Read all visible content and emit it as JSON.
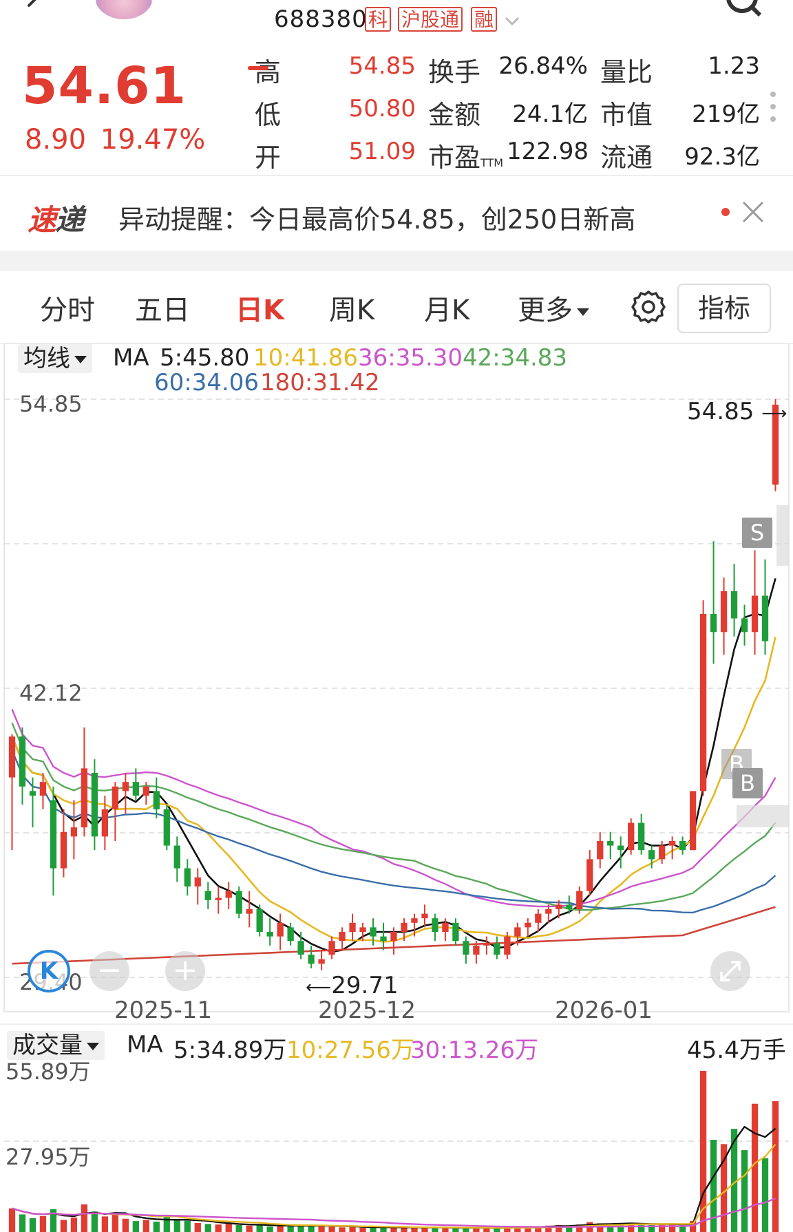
{
  "header": {
    "stock_code": "688380",
    "tags": [
      "科",
      "沪股通",
      "融"
    ]
  },
  "quote": {
    "price": "54.61",
    "change": "8.90",
    "change_pct": "19.47%",
    "high_label": "高",
    "high": "54.85",
    "low_label": "低",
    "low": "50.80",
    "open_label": "开",
    "open": "51.09",
    "turnover_label": "换手",
    "turnover": "26.84%",
    "amount_label": "金额",
    "amount": "24.1亿",
    "pe_label": "市盈",
    "pe_sub": "TTM",
    "pe": "122.98",
    "vol_ratio_label": "量比",
    "vol_ratio": "1.23",
    "mkt_cap_label": "市值",
    "mkt_cap": "219亿",
    "float_label": "流通",
    "float": "92.3亿"
  },
  "alert": {
    "logo_a": "速",
    "logo_b": "递",
    "text": "异动提醒：今日最高价54.85，创250日新高"
  },
  "tabs": {
    "items": [
      "分时",
      "五日",
      "日K",
      "周K",
      "月K",
      "更多"
    ],
    "active": "日K",
    "indicator_button": "指标"
  },
  "ma_panel": {
    "selector": "均线",
    "prefix": "MA",
    "ma5": "5:45.80",
    "ma10": "10:41.86",
    "ma36": "36:35.30",
    "ma42": "42:34.83",
    "ma60": "60:34.06",
    "ma180": "180:31.42"
  },
  "volume_panel": {
    "selector": "成交量",
    "prefix": "MA",
    "ma5": "5:34.89万",
    "ma10": "10:27.56万",
    "ma30": "30:13.26万",
    "current": "45.4万手",
    "axis_top": "55.89万",
    "axis_mid": "27.95万"
  },
  "chart_labels": {
    "price_top": "54.85",
    "price_mid": "42.12",
    "price_low": "29.40",
    "high_marker": "54.85",
    "low_marker": "29.71",
    "dates": [
      "2025-11",
      "2025-12",
      "2026-01"
    ],
    "signal_s": "S",
    "signal_b": "B",
    "k_button": "K"
  },
  "colors": {
    "up": "#e03c31",
    "down": "#1e9e3a",
    "ma5": "#111111",
    "ma10": "#e6b822",
    "ma36": "#cc55cc",
    "ma42": "#5aa85a",
    "ma60": "#3a6ea8",
    "ma180": "#d0453a"
  },
  "chart_data": {
    "type": "candlestick",
    "ylim": [
      29.4,
      54.85
    ],
    "ohlc": [
      [
        38.2,
        40.1,
        35.0,
        40.0
      ],
      [
        40.0,
        40.4,
        37.0,
        37.8
      ],
      [
        37.6,
        38.2,
        36.0,
        37.4
      ],
      [
        37.4,
        38.4,
        36.8,
        38.0
      ],
      [
        37.2,
        37.8,
        33.0,
        34.2
      ],
      [
        34.2,
        36.8,
        33.8,
        35.8
      ],
      [
        35.6,
        37.2,
        34.6,
        36.0
      ],
      [
        36.0,
        40.4,
        35.6,
        38.6
      ],
      [
        38.4,
        39.0,
        35.0,
        35.6
      ],
      [
        35.6,
        37.4,
        35.0,
        36.8
      ],
      [
        36.8,
        38.0,
        35.4,
        37.8
      ],
      [
        37.6,
        38.4,
        36.6,
        38.0
      ],
      [
        38.0,
        38.6,
        37.2,
        37.4
      ],
      [
        37.4,
        38.0,
        37.0,
        37.8
      ],
      [
        37.6,
        38.2,
        36.4,
        36.8
      ],
      [
        36.8,
        37.0,
        35.0,
        35.2
      ],
      [
        35.2,
        35.6,
        33.6,
        34.2
      ],
      [
        34.2,
        34.6,
        33.0,
        33.4
      ],
      [
        33.4,
        34.2,
        32.6,
        33.8
      ],
      [
        33.2,
        33.6,
        32.4,
        32.8
      ],
      [
        32.8,
        33.4,
        32.2,
        32.9
      ],
      [
        32.9,
        33.6,
        32.4,
        33.2
      ],
      [
        33.2,
        33.4,
        32.0,
        32.2
      ],
      [
        32.2,
        33.2,
        31.6,
        32.4
      ],
      [
        32.4,
        32.6,
        31.2,
        31.4
      ],
      [
        31.4,
        32.0,
        30.8,
        31.2
      ],
      [
        31.2,
        32.2,
        30.6,
        31.8
      ],
      [
        31.6,
        31.8,
        30.8,
        31.0
      ],
      [
        31.0,
        31.4,
        30.2,
        30.4
      ],
      [
        30.4,
        30.8,
        29.8,
        30.0
      ],
      [
        30.0,
        30.6,
        29.71,
        30.2
      ],
      [
        30.4,
        31.2,
        30.2,
        31.0
      ],
      [
        31.0,
        31.6,
        30.6,
        31.4
      ],
      [
        31.4,
        32.2,
        31.0,
        31.8
      ],
      [
        31.4,
        31.8,
        31.0,
        31.6
      ],
      [
        31.6,
        32.0,
        30.8,
        31.2
      ],
      [
        31.2,
        31.8,
        30.6,
        31.0
      ],
      [
        31.0,
        31.6,
        30.4,
        31.4
      ],
      [
        31.4,
        32.0,
        31.0,
        31.8
      ],
      [
        31.8,
        32.2,
        31.2,
        32.0
      ],
      [
        32.0,
        32.6,
        31.6,
        32.2
      ],
      [
        32.0,
        32.2,
        31.0,
        31.4
      ],
      [
        31.4,
        32.0,
        31.0,
        31.8
      ],
      [
        31.8,
        32.0,
        30.8,
        31.0
      ],
      [
        31.0,
        31.2,
        30.0,
        30.4
      ],
      [
        30.4,
        31.0,
        30.0,
        30.8
      ],
      [
        30.8,
        31.2,
        30.4,
        30.9
      ],
      [
        30.9,
        31.2,
        30.2,
        30.4
      ],
      [
        30.4,
        31.4,
        30.2,
        31.2
      ],
      [
        31.2,
        31.8,
        30.8,
        31.6
      ],
      [
        31.6,
        32.0,
        31.2,
        31.8
      ],
      [
        31.8,
        32.4,
        31.4,
        32.2
      ],
      [
        32.2,
        32.6,
        31.8,
        32.4
      ],
      [
        32.4,
        32.8,
        32.0,
        32.6
      ],
      [
        32.6,
        33.0,
        32.2,
        32.4
      ],
      [
        32.4,
        33.4,
        32.2,
        33.2
      ],
      [
        33.2,
        35.0,
        33.0,
        34.6
      ],
      [
        34.6,
        35.8,
        34.2,
        35.4
      ],
      [
        35.4,
        35.8,
        34.6,
        35.2
      ],
      [
        35.2,
        35.6,
        34.2,
        35.0
      ],
      [
        35.0,
        36.4,
        34.8,
        36.2
      ],
      [
        36.2,
        36.6,
        34.8,
        35.0
      ],
      [
        35.0,
        35.2,
        34.2,
        34.6
      ],
      [
        34.6,
        35.4,
        34.4,
        35.2
      ],
      [
        35.2,
        35.6,
        34.6,
        35.4
      ],
      [
        35.4,
        35.6,
        34.8,
        35.0
      ],
      [
        35.0,
        37.6,
        35.0,
        37.6
      ],
      [
        37.6,
        46.0,
        37.4,
        45.4
      ],
      [
        45.4,
        48.6,
        43.2,
        44.6
      ],
      [
        44.6,
        47.0,
        43.6,
        46.4
      ],
      [
        46.4,
        47.6,
        44.4,
        45.2
      ],
      [
        45.2,
        45.8,
        44.0,
        44.6
      ],
      [
        44.6,
        48.2,
        43.6,
        46.2
      ],
      [
        46.2,
        47.8,
        43.6,
        44.2
      ],
      [
        51.09,
        54.85,
        50.8,
        54.61
      ]
    ],
    "volume": [
      8.2,
      6.1,
      4.8,
      5.5,
      7.9,
      4.2,
      5.0,
      9.6,
      7.1,
      5.4,
      6.0,
      4.6,
      3.8,
      4.2,
      3.6,
      5.2,
      4.4,
      3.9,
      3.1,
      2.8,
      2.6,
      2.9,
      2.4,
      2.2,
      2.6,
      1.9,
      2.3,
      2.1,
      2.0,
      2.4,
      2.2,
      1.8,
      1.6,
      1.9,
      1.5,
      1.7,
      1.4,
      1.6,
      1.8,
      1.5,
      1.4,
      1.6,
      1.3,
      1.5,
      1.2,
      1.4,
      1.6,
      1.3,
      1.5,
      1.8,
      1.7,
      2.0,
      2.2,
      2.4,
      2.1,
      2.6,
      3.4,
      3.0,
      2.8,
      2.5,
      3.2,
      2.9,
      2.4,
      2.6,
      2.7,
      2.3,
      3.8,
      55.89,
      32.0,
      30.5,
      35.8,
      28.4,
      44.5,
      25.6,
      45.4
    ]
  }
}
